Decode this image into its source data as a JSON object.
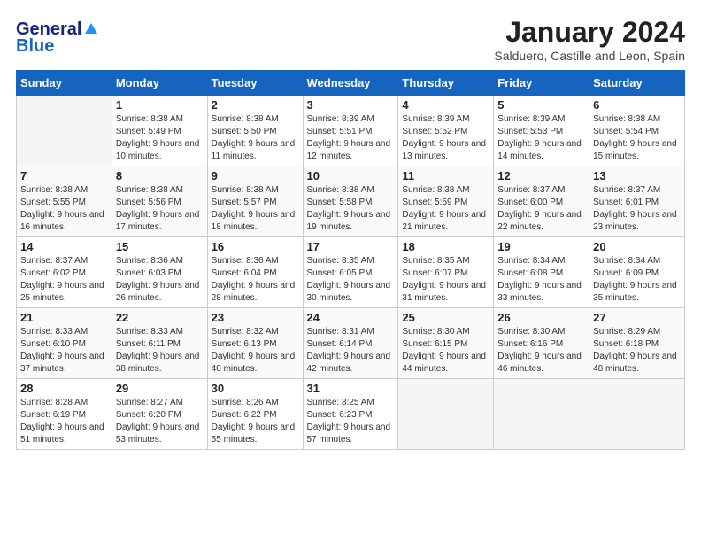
{
  "header": {
    "logo": {
      "general": "General",
      "blue": "Blue"
    },
    "title": "January 2024",
    "subtitle": "Salduero, Castille and Leon, Spain"
  },
  "weekdays": [
    "Sunday",
    "Monday",
    "Tuesday",
    "Wednesday",
    "Thursday",
    "Friday",
    "Saturday"
  ],
  "weeks": [
    [
      {
        "day": "",
        "sunrise": "",
        "sunset": "",
        "daylight": ""
      },
      {
        "day": "1",
        "sunrise": "Sunrise: 8:38 AM",
        "sunset": "Sunset: 5:49 PM",
        "daylight": "Daylight: 9 hours and 10 minutes."
      },
      {
        "day": "2",
        "sunrise": "Sunrise: 8:38 AM",
        "sunset": "Sunset: 5:50 PM",
        "daylight": "Daylight: 9 hours and 11 minutes."
      },
      {
        "day": "3",
        "sunrise": "Sunrise: 8:39 AM",
        "sunset": "Sunset: 5:51 PM",
        "daylight": "Daylight: 9 hours and 12 minutes."
      },
      {
        "day": "4",
        "sunrise": "Sunrise: 8:39 AM",
        "sunset": "Sunset: 5:52 PM",
        "daylight": "Daylight: 9 hours and 13 minutes."
      },
      {
        "day": "5",
        "sunrise": "Sunrise: 8:39 AM",
        "sunset": "Sunset: 5:53 PM",
        "daylight": "Daylight: 9 hours and 14 minutes."
      },
      {
        "day": "6",
        "sunrise": "Sunrise: 8:38 AM",
        "sunset": "Sunset: 5:54 PM",
        "daylight": "Daylight: 9 hours and 15 minutes."
      }
    ],
    [
      {
        "day": "7",
        "sunrise": "Sunrise: 8:38 AM",
        "sunset": "Sunset: 5:55 PM",
        "daylight": "Daylight: 9 hours and 16 minutes."
      },
      {
        "day": "8",
        "sunrise": "Sunrise: 8:38 AM",
        "sunset": "Sunset: 5:56 PM",
        "daylight": "Daylight: 9 hours and 17 minutes."
      },
      {
        "day": "9",
        "sunrise": "Sunrise: 8:38 AM",
        "sunset": "Sunset: 5:57 PM",
        "daylight": "Daylight: 9 hours and 18 minutes."
      },
      {
        "day": "10",
        "sunrise": "Sunrise: 8:38 AM",
        "sunset": "Sunset: 5:58 PM",
        "daylight": "Daylight: 9 hours and 19 minutes."
      },
      {
        "day": "11",
        "sunrise": "Sunrise: 8:38 AM",
        "sunset": "Sunset: 5:59 PM",
        "daylight": "Daylight: 9 hours and 21 minutes."
      },
      {
        "day": "12",
        "sunrise": "Sunrise: 8:37 AM",
        "sunset": "Sunset: 6:00 PM",
        "daylight": "Daylight: 9 hours and 22 minutes."
      },
      {
        "day": "13",
        "sunrise": "Sunrise: 8:37 AM",
        "sunset": "Sunset: 6:01 PM",
        "daylight": "Daylight: 9 hours and 23 minutes."
      }
    ],
    [
      {
        "day": "14",
        "sunrise": "Sunrise: 8:37 AM",
        "sunset": "Sunset: 6:02 PM",
        "daylight": "Daylight: 9 hours and 25 minutes."
      },
      {
        "day": "15",
        "sunrise": "Sunrise: 8:36 AM",
        "sunset": "Sunset: 6:03 PM",
        "daylight": "Daylight: 9 hours and 26 minutes."
      },
      {
        "day": "16",
        "sunrise": "Sunrise: 8:36 AM",
        "sunset": "Sunset: 6:04 PM",
        "daylight": "Daylight: 9 hours and 28 minutes."
      },
      {
        "day": "17",
        "sunrise": "Sunrise: 8:35 AM",
        "sunset": "Sunset: 6:05 PM",
        "daylight": "Daylight: 9 hours and 30 minutes."
      },
      {
        "day": "18",
        "sunrise": "Sunrise: 8:35 AM",
        "sunset": "Sunset: 6:07 PM",
        "daylight": "Daylight: 9 hours and 31 minutes."
      },
      {
        "day": "19",
        "sunrise": "Sunrise: 8:34 AM",
        "sunset": "Sunset: 6:08 PM",
        "daylight": "Daylight: 9 hours and 33 minutes."
      },
      {
        "day": "20",
        "sunrise": "Sunrise: 8:34 AM",
        "sunset": "Sunset: 6:09 PM",
        "daylight": "Daylight: 9 hours and 35 minutes."
      }
    ],
    [
      {
        "day": "21",
        "sunrise": "Sunrise: 8:33 AM",
        "sunset": "Sunset: 6:10 PM",
        "daylight": "Daylight: 9 hours and 37 minutes."
      },
      {
        "day": "22",
        "sunrise": "Sunrise: 8:33 AM",
        "sunset": "Sunset: 6:11 PM",
        "daylight": "Daylight: 9 hours and 38 minutes."
      },
      {
        "day": "23",
        "sunrise": "Sunrise: 8:32 AM",
        "sunset": "Sunset: 6:13 PM",
        "daylight": "Daylight: 9 hours and 40 minutes."
      },
      {
        "day": "24",
        "sunrise": "Sunrise: 8:31 AM",
        "sunset": "Sunset: 6:14 PM",
        "daylight": "Daylight: 9 hours and 42 minutes."
      },
      {
        "day": "25",
        "sunrise": "Sunrise: 8:30 AM",
        "sunset": "Sunset: 6:15 PM",
        "daylight": "Daylight: 9 hours and 44 minutes."
      },
      {
        "day": "26",
        "sunrise": "Sunrise: 8:30 AM",
        "sunset": "Sunset: 6:16 PM",
        "daylight": "Daylight: 9 hours and 46 minutes."
      },
      {
        "day": "27",
        "sunrise": "Sunrise: 8:29 AM",
        "sunset": "Sunset: 6:18 PM",
        "daylight": "Daylight: 9 hours and 48 minutes."
      }
    ],
    [
      {
        "day": "28",
        "sunrise": "Sunrise: 8:28 AM",
        "sunset": "Sunset: 6:19 PM",
        "daylight": "Daylight: 9 hours and 51 minutes."
      },
      {
        "day": "29",
        "sunrise": "Sunrise: 8:27 AM",
        "sunset": "Sunset: 6:20 PM",
        "daylight": "Daylight: 9 hours and 53 minutes."
      },
      {
        "day": "30",
        "sunrise": "Sunrise: 8:26 AM",
        "sunset": "Sunset: 6:22 PM",
        "daylight": "Daylight: 9 hours and 55 minutes."
      },
      {
        "day": "31",
        "sunrise": "Sunrise: 8:25 AM",
        "sunset": "Sunset: 6:23 PM",
        "daylight": "Daylight: 9 hours and 57 minutes."
      },
      {
        "day": "",
        "sunrise": "",
        "sunset": "",
        "daylight": ""
      },
      {
        "day": "",
        "sunrise": "",
        "sunset": "",
        "daylight": ""
      },
      {
        "day": "",
        "sunrise": "",
        "sunset": "",
        "daylight": ""
      }
    ]
  ]
}
